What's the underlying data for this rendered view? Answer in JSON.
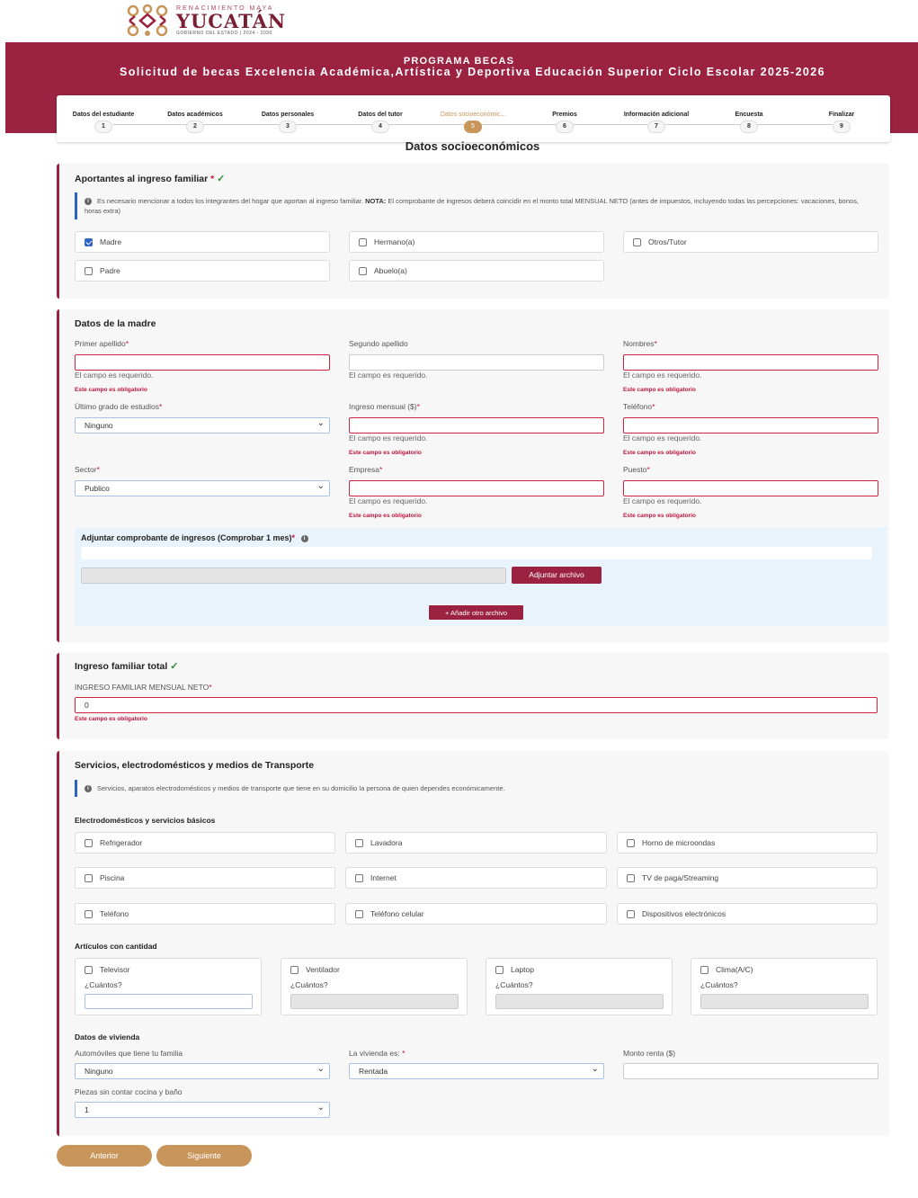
{
  "brand": {
    "tagline": "RENACIMIENTO MAYA",
    "name": "YUCATÁN",
    "gov": "GOBIERNO DEL ESTADO | 2024 - 2030"
  },
  "header": {
    "title": "PROGRAMA BECAS",
    "subtitle": "Solicitud de becas Excelencia Académica,Artística y Deportiva Educación Superior Ciclo Escolar 2025-2026"
  },
  "stepper": {
    "steps": [
      {
        "label": "Datos del estudiante",
        "num": "1"
      },
      {
        "label": "Datos académicos",
        "num": "2"
      },
      {
        "label": "Datos personales",
        "num": "3"
      },
      {
        "label": "Datos del tutor",
        "num": "4"
      },
      {
        "label": "Datos socioeconómic...",
        "num": "5"
      },
      {
        "label": "Premios",
        "num": "6"
      },
      {
        "label": "Información adicional",
        "num": "7"
      },
      {
        "label": "Encuesta",
        "num": "8"
      },
      {
        "label": "Finalizar",
        "num": "9"
      }
    ],
    "active": 5
  },
  "page_title": "Datos socioeconómicos",
  "aportantes": {
    "title": "Aportantes al ingreso familiar",
    "info_lead": "Es necesario mencionar a todos los integrantes del hogar que aportan al ingreso familiar.",
    "info_bold": "NOTA:",
    "info_rest": "El comprobante de ingresos deberá coincidir en el monto total MENSUAL NETO (antes de impuestos, incluyendo todas las percepciones: vacaciones, bonos, horas extra)",
    "options": {
      "madre": "Madre",
      "hermano": "Hermano(a)",
      "otros": "Otros/Tutor",
      "padre": "Padre",
      "abuelo": "Abuelo(a)"
    }
  },
  "madre": {
    "title": "Datos de la madre",
    "primer_apellido": "Primer apellido",
    "segundo_apellido": "Segundo apellido",
    "nombres": "Nombres",
    "ultimo_grado": "Último grado de estudios",
    "ultimo_grado_value": "Ninguno",
    "ingreso": "Ingreso mensual ($)",
    "telefono": "Teléfono",
    "sector": "Sector",
    "sector_value": "Publico",
    "empresa": "Empresa",
    "puesto": "Puesto",
    "err_required": "El campo es requerido.",
    "err_obligatorio": "Este campo es obligatorio",
    "attach_title": "Adjuntar comprobante de ingresos (Comprobar 1 mes)",
    "attach_button": "Adjuntar archivo",
    "add_file": "+ Añadir otro archivo"
  },
  "ingreso_total": {
    "title": "Ingreso familiar total",
    "label": "INGRESO FAMILIAR MENSUAL NETO",
    "value": "0",
    "err": "Este campo es obligatorio"
  },
  "servicios": {
    "title": "Servicios, electrodomésticos y medios de Transporte",
    "info": "Servicios, aparatos electrodomésticos y medios de transporte que tiene en su domicilio la persona de quien dependes económicamente.",
    "basicos_title": "Electrodomésticos y servicios básicos",
    "basicos": [
      "Refrigerador",
      "Lavadora",
      "Horno de microondas",
      "Piscina",
      "Internet",
      "TV de paga/Streaming",
      "Teléfono",
      "Teléfono celular",
      "Dispositivos electrónicos"
    ],
    "articulos_title": "Artículos con cantidad",
    "articulos": [
      "Televisor",
      "Ventilador",
      "Laptop",
      "Clima(A/C)"
    ],
    "cuantos": "¿Cuántos?",
    "vivienda_title": "Datos de vivienda",
    "autos_label": "Automóviles que tiene tu familia",
    "autos_value": "Ninguno",
    "vivienda_label": "La vivienda es:",
    "vivienda_value": "Rentada",
    "renta_label": "Monto renta ($)",
    "piezas_label": "Piezas sin contar cocina y baño",
    "piezas_value": "1"
  },
  "nav": {
    "prev": "Anterior",
    "next": "Siguiente"
  }
}
